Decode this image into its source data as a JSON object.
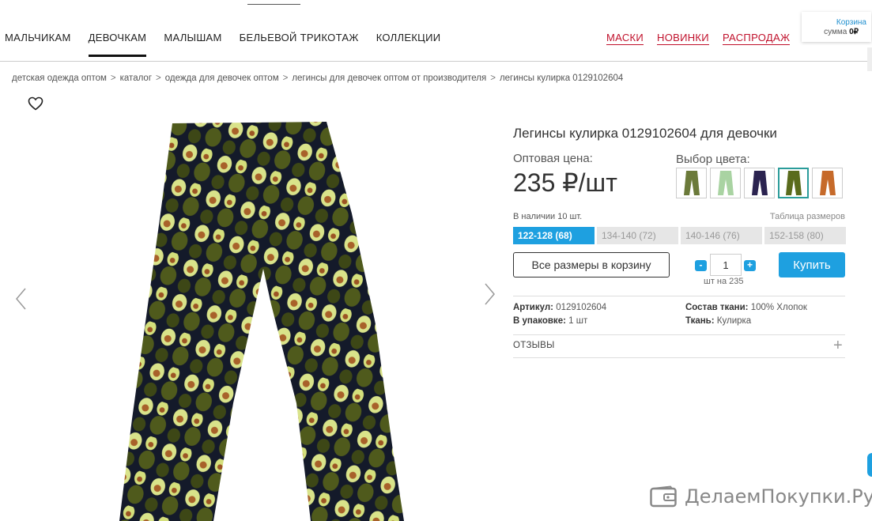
{
  "nav": {
    "left": [
      "МАЛЬЧИКАМ",
      "ДЕВОЧКАМ",
      "МАЛЫШАМ",
      "БЕЛЬЕВОЙ ТРИКОТАЖ",
      "КОЛЛЕКЦИИ"
    ],
    "active": "ДЕВОЧКАМ",
    "right": [
      "МАСКИ",
      "НОВИНКИ",
      "РАСПРОДАЖ"
    ],
    "accent_color": "#c0102b"
  },
  "cart": {
    "label": "Корзина",
    "sum_label": "сумма",
    "sum_value": "0₽"
  },
  "breadcrumb": [
    "детская одежда оптом",
    "каталог",
    "одежда для девочек оптом",
    "легинсы для девочек оптом от производителя",
    "легинсы кулирка 0129102604"
  ],
  "breadcrumb_separator": ">",
  "product": {
    "title": "Легинсы кулирка 0129102604 для девочки",
    "price_label": "Оптовая цена:",
    "price": "235 ₽/шт",
    "color_label": "Выбор цвета:",
    "colors": [
      {
        "name": "olive-avocado",
        "color": "#6b7a3a"
      },
      {
        "name": "light-green",
        "color": "#a9d3a2"
      },
      {
        "name": "navy-purple",
        "color": "#2b2350"
      },
      {
        "name": "avocado-selected",
        "color": "#5a6b1c"
      },
      {
        "name": "orange-pattern",
        "color": "#c66a2a"
      }
    ],
    "selected_color_index": 3,
    "stock_text": "В наличии 10 шт.",
    "size_table_link": "Таблица размеров",
    "sizes": [
      "122-128 (68)",
      "134-140 (72)",
      "140-146 (76)",
      "152-158 (80)"
    ],
    "active_size_index": 0,
    "all_sizes_button": "Все размеры в корзину",
    "quantity": "1",
    "minus": "-",
    "plus": "+",
    "qty_caption": "шт на 235",
    "buy_button": "Купить",
    "article_label": "Артикул:",
    "article_value": "0129102604",
    "pack_label": "В упаковке:",
    "pack_value": "1 шт",
    "composition_label": "Состав ткани:",
    "composition_value": "100% Хлопок",
    "fabric_label": "Ткань:",
    "fabric_value": "Кулирка",
    "reviews": "ОТЗЫВЫ",
    "reviews_toggle": "+"
  },
  "accent_blue": "#1ea0e0",
  "watermark": "ДелаемПокупки.Ру",
  "icons": [
    "heart-icon",
    "chevron-left-icon",
    "chevron-right-icon",
    "wallet-icon"
  ]
}
